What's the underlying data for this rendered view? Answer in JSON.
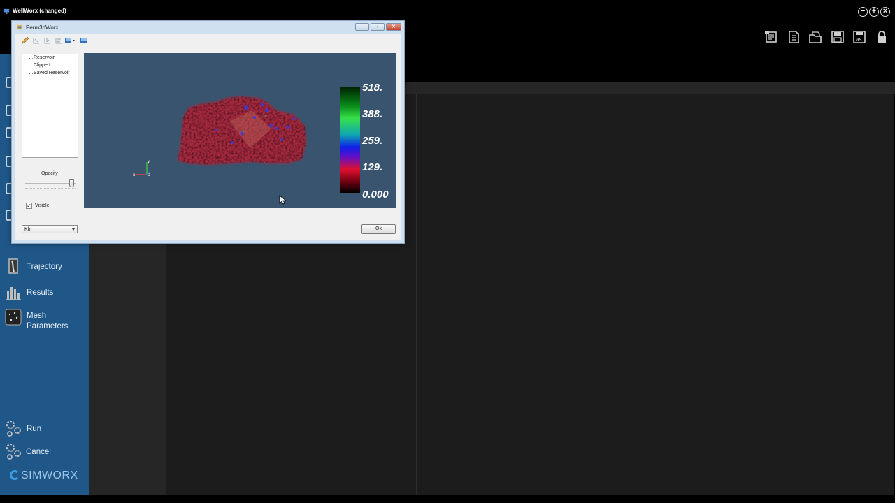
{
  "app": {
    "title": "WellWorx (changed)",
    "window_controls": {
      "minimize": "−",
      "maximize": "+",
      "close": "×"
    }
  },
  "toolbar_icons": [
    "report-icon",
    "document-icon",
    "open-folder-icon",
    "save-icon",
    "save-as-icon",
    "lock-icon"
  ],
  "toolbar_save_as_text": "as",
  "sidebar": {
    "items": [
      {
        "label": "Trajectory",
        "icon": "trajectory-icon"
      },
      {
        "label": "Results",
        "icon": "results-chart-icon"
      },
      {
        "label": "Mesh Parameters",
        "icon": "mesh-icon"
      }
    ],
    "actions": [
      {
        "label": "Run",
        "icon": "run-gears-icon"
      },
      {
        "label": "Cancel",
        "icon": "cancel-gears-icon"
      }
    ],
    "logo": "SIMWORX"
  },
  "dialog": {
    "title": "Perm3dWorx",
    "controls": {
      "minimize": "‒",
      "maximize": "▫",
      "close": "✕"
    },
    "toolbar_buttons": [
      "pencil-icon",
      "view-x-icon",
      "view-y-icon",
      "view-z-icon",
      "camera-dropdown-icon",
      "export-image-icon"
    ],
    "tree": [
      "Reservoir",
      "Clipped",
      "Saved Reservoir"
    ],
    "opacity_label": "Opacity",
    "opacity_value": 0.95,
    "visible_label": "Visible",
    "visible_checked": true,
    "property_select": "Kh",
    "ok_label": "Ok",
    "axes": {
      "x": "x",
      "y": "y",
      "z": "z"
    },
    "legend": [
      "518.",
      "388.",
      "259.",
      "129.",
      "0.000"
    ],
    "colors": {
      "viewport_bg": "#39546f",
      "reservoir_primary": "#b0283a",
      "reservoir_high": "#3a3ae0"
    }
  }
}
